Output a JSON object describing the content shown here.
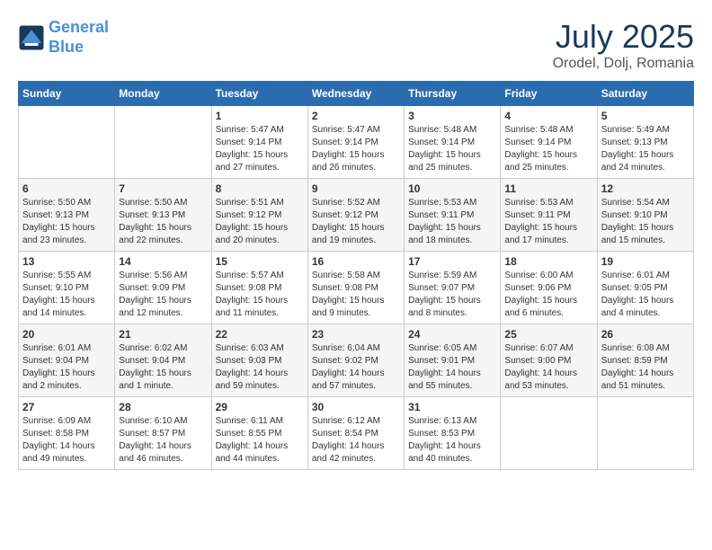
{
  "header": {
    "logo_line1": "General",
    "logo_line2": "Blue",
    "month": "July 2025",
    "location": "Orodel, Dolj, Romania"
  },
  "columns": [
    "Sunday",
    "Monday",
    "Tuesday",
    "Wednesday",
    "Thursday",
    "Friday",
    "Saturday"
  ],
  "weeks": [
    [
      {
        "day": "",
        "text": ""
      },
      {
        "day": "",
        "text": ""
      },
      {
        "day": "1",
        "text": "Sunrise: 5:47 AM\nSunset: 9:14 PM\nDaylight: 15 hours and 27 minutes."
      },
      {
        "day": "2",
        "text": "Sunrise: 5:47 AM\nSunset: 9:14 PM\nDaylight: 15 hours and 26 minutes."
      },
      {
        "day": "3",
        "text": "Sunrise: 5:48 AM\nSunset: 9:14 PM\nDaylight: 15 hours and 25 minutes."
      },
      {
        "day": "4",
        "text": "Sunrise: 5:48 AM\nSunset: 9:14 PM\nDaylight: 15 hours and 25 minutes."
      },
      {
        "day": "5",
        "text": "Sunrise: 5:49 AM\nSunset: 9:13 PM\nDaylight: 15 hours and 24 minutes."
      }
    ],
    [
      {
        "day": "6",
        "text": "Sunrise: 5:50 AM\nSunset: 9:13 PM\nDaylight: 15 hours and 23 minutes."
      },
      {
        "day": "7",
        "text": "Sunrise: 5:50 AM\nSunset: 9:13 PM\nDaylight: 15 hours and 22 minutes."
      },
      {
        "day": "8",
        "text": "Sunrise: 5:51 AM\nSunset: 9:12 PM\nDaylight: 15 hours and 20 minutes."
      },
      {
        "day": "9",
        "text": "Sunrise: 5:52 AM\nSunset: 9:12 PM\nDaylight: 15 hours and 19 minutes."
      },
      {
        "day": "10",
        "text": "Sunrise: 5:53 AM\nSunset: 9:11 PM\nDaylight: 15 hours and 18 minutes."
      },
      {
        "day": "11",
        "text": "Sunrise: 5:53 AM\nSunset: 9:11 PM\nDaylight: 15 hours and 17 minutes."
      },
      {
        "day": "12",
        "text": "Sunrise: 5:54 AM\nSunset: 9:10 PM\nDaylight: 15 hours and 15 minutes."
      }
    ],
    [
      {
        "day": "13",
        "text": "Sunrise: 5:55 AM\nSunset: 9:10 PM\nDaylight: 15 hours and 14 minutes."
      },
      {
        "day": "14",
        "text": "Sunrise: 5:56 AM\nSunset: 9:09 PM\nDaylight: 15 hours and 12 minutes."
      },
      {
        "day": "15",
        "text": "Sunrise: 5:57 AM\nSunset: 9:08 PM\nDaylight: 15 hours and 11 minutes."
      },
      {
        "day": "16",
        "text": "Sunrise: 5:58 AM\nSunset: 9:08 PM\nDaylight: 15 hours and 9 minutes."
      },
      {
        "day": "17",
        "text": "Sunrise: 5:59 AM\nSunset: 9:07 PM\nDaylight: 15 hours and 8 minutes."
      },
      {
        "day": "18",
        "text": "Sunrise: 6:00 AM\nSunset: 9:06 PM\nDaylight: 15 hours and 6 minutes."
      },
      {
        "day": "19",
        "text": "Sunrise: 6:01 AM\nSunset: 9:05 PM\nDaylight: 15 hours and 4 minutes."
      }
    ],
    [
      {
        "day": "20",
        "text": "Sunrise: 6:01 AM\nSunset: 9:04 PM\nDaylight: 15 hours and 2 minutes."
      },
      {
        "day": "21",
        "text": "Sunrise: 6:02 AM\nSunset: 9:04 PM\nDaylight: 15 hours and 1 minute."
      },
      {
        "day": "22",
        "text": "Sunrise: 6:03 AM\nSunset: 9:03 PM\nDaylight: 14 hours and 59 minutes."
      },
      {
        "day": "23",
        "text": "Sunrise: 6:04 AM\nSunset: 9:02 PM\nDaylight: 14 hours and 57 minutes."
      },
      {
        "day": "24",
        "text": "Sunrise: 6:05 AM\nSunset: 9:01 PM\nDaylight: 14 hours and 55 minutes."
      },
      {
        "day": "25",
        "text": "Sunrise: 6:07 AM\nSunset: 9:00 PM\nDaylight: 14 hours and 53 minutes."
      },
      {
        "day": "26",
        "text": "Sunrise: 6:08 AM\nSunset: 8:59 PM\nDaylight: 14 hours and 51 minutes."
      }
    ],
    [
      {
        "day": "27",
        "text": "Sunrise: 6:09 AM\nSunset: 8:58 PM\nDaylight: 14 hours and 49 minutes."
      },
      {
        "day": "28",
        "text": "Sunrise: 6:10 AM\nSunset: 8:57 PM\nDaylight: 14 hours and 46 minutes."
      },
      {
        "day": "29",
        "text": "Sunrise: 6:11 AM\nSunset: 8:55 PM\nDaylight: 14 hours and 44 minutes."
      },
      {
        "day": "30",
        "text": "Sunrise: 6:12 AM\nSunset: 8:54 PM\nDaylight: 14 hours and 42 minutes."
      },
      {
        "day": "31",
        "text": "Sunrise: 6:13 AM\nSunset: 8:53 PM\nDaylight: 14 hours and 40 minutes."
      },
      {
        "day": "",
        "text": ""
      },
      {
        "day": "",
        "text": ""
      }
    ]
  ]
}
